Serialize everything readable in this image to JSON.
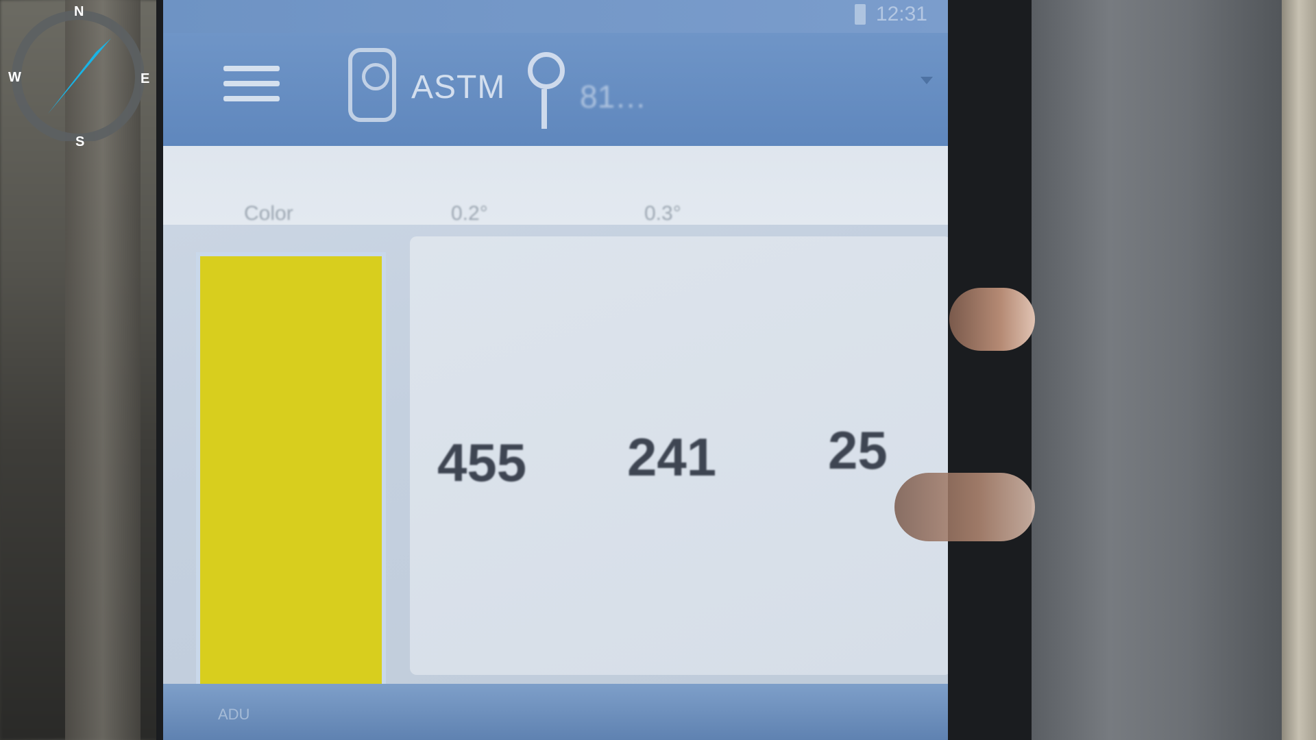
{
  "compass": {
    "north": "N",
    "south": "S",
    "east": "E",
    "west": "W",
    "ring_color": "#5c6063",
    "needle_color": "#19b4e6"
  },
  "status_bar": {
    "time": "12:31"
  },
  "app_bar": {
    "method": "ASTM",
    "sample": "81…"
  },
  "table": {
    "headers": [
      "Color",
      "0.2°",
      "0.3°"
    ]
  },
  "reading": {
    "swatch_color": "#d8ce1e",
    "values": [
      "455",
      "241",
      "25"
    ]
  },
  "bottom_bar": {
    "label": "ADU"
  }
}
